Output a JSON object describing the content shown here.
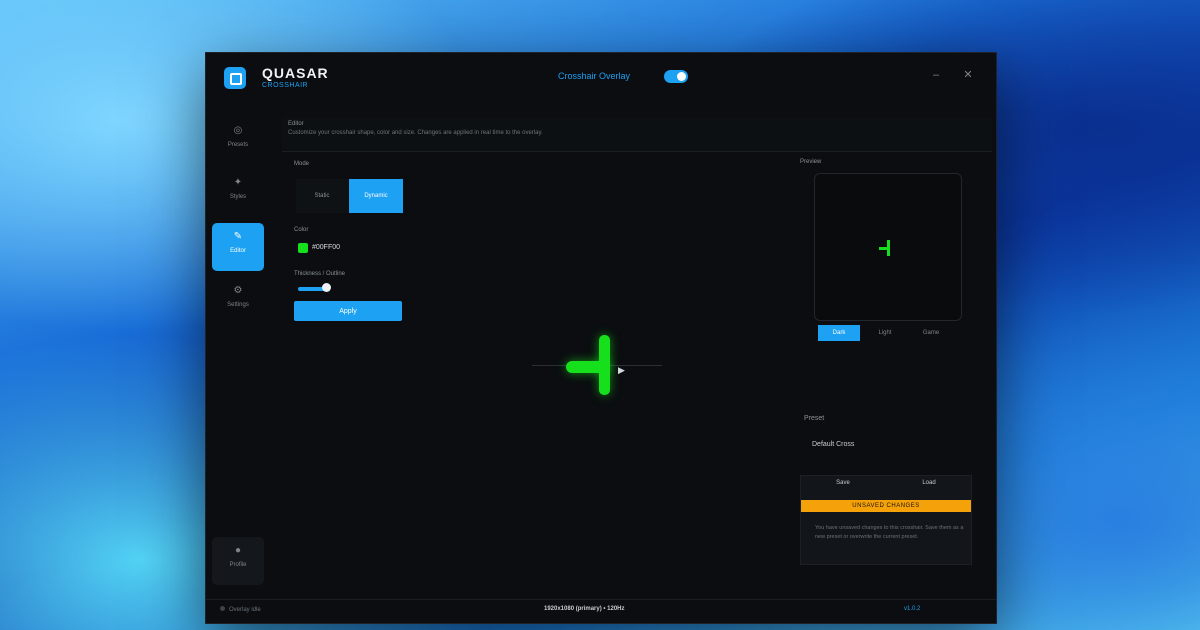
{
  "app": {
    "brand": "QUASAR",
    "brand_sub": "CROSSHAIR"
  },
  "titlebar": {
    "overlay_label": "Crosshair Overlay",
    "minimize": "–",
    "close": "✕"
  },
  "sidebar": {
    "items": [
      {
        "label": "Presets",
        "icon": "◎"
      },
      {
        "label": "Styles",
        "icon": "✦"
      },
      {
        "label": "Editor",
        "icon": "✎"
      },
      {
        "label": "Settings",
        "icon": "⚙"
      }
    ],
    "account": {
      "label": "Profile",
      "icon": "●"
    }
  },
  "topinfo": {
    "title": "Editor",
    "desc": "Customize your crosshair shape, color and size. Changes are applied in real time to the overlay."
  },
  "editor": {
    "mode_label": "Mode",
    "modes": [
      "Static",
      "Dynamic"
    ],
    "color_label": "Color",
    "color_name": "#00FF00",
    "thickness_label": "Thickness / Outline",
    "apply_label": "Apply"
  },
  "preview": {
    "label": "Preview",
    "tabs": [
      "Dark",
      "Light",
      "Game"
    ]
  },
  "presets": {
    "label": "Preset",
    "name": "Default Cross",
    "tab_left": "Save",
    "tab_right": "Load",
    "warning": "UNSAVED CHANGES",
    "text": "You have unsaved changes to this crosshair. Save them as a new preset or overwrite the current preset."
  },
  "status": {
    "left": "Overlay idle",
    "middle": "1920x1080 (primary) • 120Hz",
    "right": "v1.0.2"
  },
  "colors": {
    "accent": "#1da1f2",
    "crosshair": "#16e01c",
    "warning": "#f5a20a"
  }
}
